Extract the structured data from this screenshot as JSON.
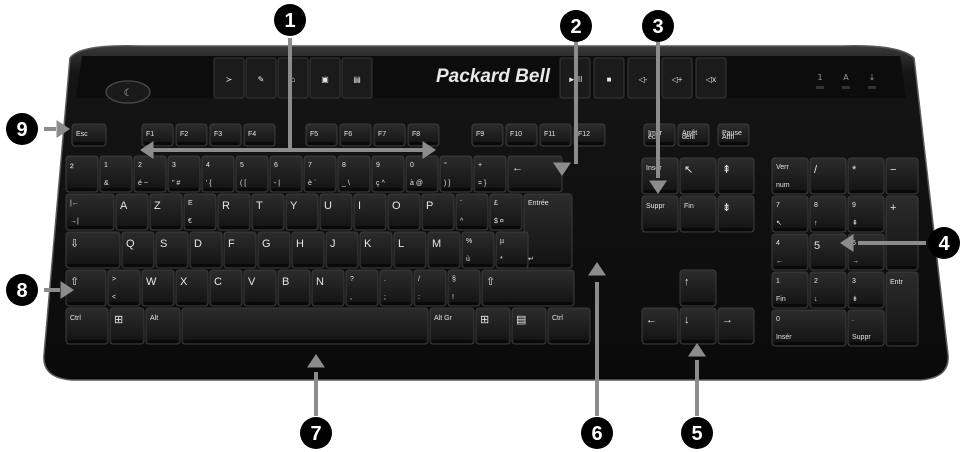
{
  "brand": "Packard Bell",
  "colors": {
    "body": "#111111",
    "key": "#1c1c1c",
    "callout": "#000000",
    "arrow": "#8c8c8c"
  },
  "callout_labels": [
    "1",
    "2",
    "3",
    "4",
    "5",
    "6",
    "7",
    "8",
    "9"
  ],
  "media_keys": [
    "≻",
    "✎",
    "⌂",
    "▣",
    "▤",
    "►/II",
    "■",
    "◁-",
    "◁+",
    "◁x"
  ],
  "led_labels": [
    "1",
    "A",
    "↓"
  ],
  "rows": {
    "fn": [
      {
        "l1": "Esc",
        "n": "esc"
      },
      {
        "l1": "F1",
        "n": "f1"
      },
      {
        "l1": "F2",
        "n": "f2"
      },
      {
        "l1": "F3",
        "n": "f3"
      },
      {
        "l1": "F4",
        "n": "f4"
      },
      {
        "l1": "F5",
        "n": "f5"
      },
      {
        "l1": "F6",
        "n": "f6"
      },
      {
        "l1": "F7",
        "n": "f7"
      },
      {
        "l1": "F8",
        "n": "f8"
      },
      {
        "l1": "F9",
        "n": "f9"
      },
      {
        "l1": "F10",
        "n": "f10"
      },
      {
        "l1": "F11",
        "n": "f11"
      },
      {
        "l1": "F12",
        "n": "f12"
      },
      {
        "l1": "Impr",
        "l2": "écr",
        "n": "print"
      },
      {
        "l1": "Arrêt",
        "l2": "défil",
        "n": "scroll-lock"
      },
      {
        "l1": "Pause",
        "l2": "Attn",
        "n": "pause"
      }
    ],
    "num": [
      {
        "l1": "²",
        "n": "sup2"
      },
      {
        "l1": "1",
        "l2": "&",
        "n": "1"
      },
      {
        "l1": "2",
        "l2": "é ~",
        "n": "2"
      },
      {
        "l1": "3",
        "l2": "\" #",
        "n": "3"
      },
      {
        "l1": "4",
        "l2": "' {",
        "n": "4"
      },
      {
        "l1": "5",
        "l2": "( [",
        "n": "5"
      },
      {
        "l1": "6",
        "l2": "- |",
        "n": "6"
      },
      {
        "l1": "7",
        "l2": "è `",
        "n": "7"
      },
      {
        "l1": "8",
        "l2": "_ \\",
        "n": "8"
      },
      {
        "l1": "9",
        "l2": "ç ^",
        "n": "9"
      },
      {
        "l1": "0",
        "l2": "à @",
        "n": "0"
      },
      {
        "l1": "°",
        "l2": ") ]",
        "n": "degree"
      },
      {
        "l1": "+",
        "l2": "= }",
        "n": "plus"
      },
      {
        "l1": "←",
        "n": "backspace"
      }
    ],
    "top": [
      {
        "l1": "|←",
        "l2": "→|",
        "n": "tab"
      },
      {
        "l1": "A",
        "n": "a"
      },
      {
        "l1": "Z",
        "n": "z"
      },
      {
        "l1": "E",
        "l2": "€",
        "n": "e"
      },
      {
        "l1": "R",
        "n": "r"
      },
      {
        "l1": "T",
        "n": "t"
      },
      {
        "l1": "Y",
        "n": "y"
      },
      {
        "l1": "U",
        "n": "u"
      },
      {
        "l1": "I",
        "n": "i"
      },
      {
        "l1": "O",
        "n": "o"
      },
      {
        "l1": "P",
        "n": "p"
      },
      {
        "l1": "¨",
        "l2": "^",
        "n": "circumflex"
      },
      {
        "l1": "£",
        "l2": "$ ¤",
        "n": "dollar"
      },
      {
        "l1": "Entrée",
        "l2": "↵",
        "n": "enter"
      }
    ],
    "home": [
      {
        "l1": "⇩",
        "n": "caps-lock"
      },
      {
        "l1": "Q",
        "n": "q"
      },
      {
        "l1": "S",
        "n": "s"
      },
      {
        "l1": "D",
        "n": "d"
      },
      {
        "l1": "F",
        "n": "f"
      },
      {
        "l1": "G",
        "n": "g"
      },
      {
        "l1": "H",
        "n": "h"
      },
      {
        "l1": "J",
        "n": "j"
      },
      {
        "l1": "K",
        "n": "k"
      },
      {
        "l1": "L",
        "n": "l"
      },
      {
        "l1": "M",
        "n": "m"
      },
      {
        "l1": "%",
        "l2": "ù",
        "n": "percent"
      },
      {
        "l1": "µ",
        "l2": "*",
        "n": "mu"
      }
    ],
    "bottom": [
      {
        "l1": "⇧",
        "n": "shift-left"
      },
      {
        "l1": ">",
        "l2": "<",
        "n": "angle"
      },
      {
        "l1": "W",
        "n": "w"
      },
      {
        "l1": "X",
        "n": "x"
      },
      {
        "l1": "C",
        "n": "c"
      },
      {
        "l1": "V",
        "n": "v"
      },
      {
        "l1": "B",
        "n": "b"
      },
      {
        "l1": "N",
        "n": "n"
      },
      {
        "l1": "?",
        "l2": ",",
        "n": "question"
      },
      {
        "l1": ".",
        "l2": ";",
        "n": "period"
      },
      {
        "l1": "/",
        "l2": ":",
        "n": "slash"
      },
      {
        "l1": "§",
        "l2": "!",
        "n": "section"
      },
      {
        "l1": "⇧",
        "n": "shift-right"
      }
    ],
    "space": [
      {
        "l1": "Ctrl",
        "n": "ctrl-left"
      },
      {
        "l1": "⊞",
        "n": "win-left"
      },
      {
        "l1": "Alt",
        "n": "alt"
      },
      {
        "l1": "",
        "n": "space"
      },
      {
        "l1": "Alt Gr",
        "n": "alt-gr"
      },
      {
        "l1": "⊞",
        "n": "win-right"
      },
      {
        "l1": "▤",
        "n": "menu"
      },
      {
        "l1": "Ctrl",
        "n": "ctrl-right"
      }
    ],
    "nav": [
      {
        "l1": "Insér",
        "n": "insert"
      },
      {
        "l1": "↖",
        "n": "home"
      },
      {
        "l1": "⇞",
        "n": "page-up"
      },
      {
        "l1": "Suppr",
        "n": "delete"
      },
      {
        "l1": "Fin",
        "n": "end"
      },
      {
        "l1": "⇟",
        "n": "page-down"
      },
      {
        "l1": "↑",
        "n": "arrow-up"
      },
      {
        "l1": "←",
        "n": "arrow-left"
      },
      {
        "l1": "↓",
        "n": "arrow-down"
      },
      {
        "l1": "→",
        "n": "arrow-right"
      }
    ],
    "numpad": [
      {
        "l1": "Verr",
        "l2": "num",
        "n": "num-lock"
      },
      {
        "l1": "/",
        "n": "np-divide"
      },
      {
        "l1": "*",
        "n": "np-multiply"
      },
      {
        "l1": "−",
        "n": "np-minus"
      },
      {
        "l1": "7",
        "l2": "↖",
        "n": "np-7"
      },
      {
        "l1": "8",
        "l2": "↑",
        "n": "np-8"
      },
      {
        "l1": "9",
        "l2": "⇞",
        "n": "np-9"
      },
      {
        "l1": "+",
        "n": "np-plus"
      },
      {
        "l1": "4",
        "l2": "←",
        "n": "np-4"
      },
      {
        "l1": "5",
        "n": "np-5"
      },
      {
        "l1": "6",
        "l2": "→",
        "n": "np-6"
      },
      {
        "l1": "1",
        "l2": "Fin",
        "n": "np-1"
      },
      {
        "l1": "2",
        "l2": "↓",
        "n": "np-2"
      },
      {
        "l1": "3",
        "l2": "⇟",
        "n": "np-3"
      },
      {
        "l1": "Entr",
        "n": "np-enter"
      },
      {
        "l1": "0",
        "l2": "Insér",
        "n": "np-0"
      },
      {
        "l1": ".",
        "l2": "Suppr",
        "n": "np-decimal"
      }
    ]
  }
}
